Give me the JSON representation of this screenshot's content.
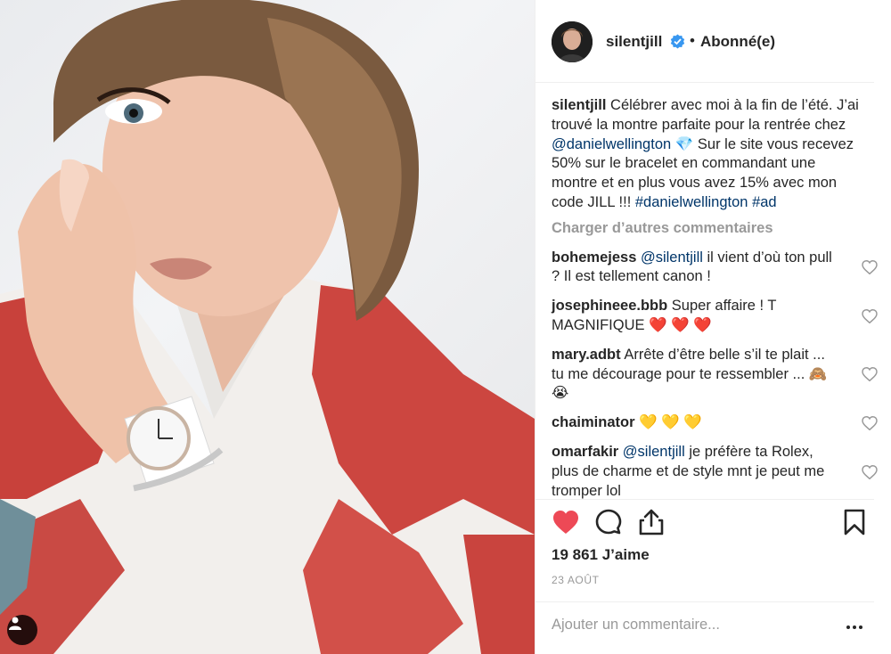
{
  "header": {
    "username": "silentjill",
    "separator": "•",
    "follow_status": "Abonné(e)"
  },
  "caption": {
    "username": "silentjill",
    "text_1": "Célébrer avec moi à la fin de l’été. J’ai trouvé la montre parfaite pour la rentrée chez ",
    "mention": "@danielwellington",
    "emoji": "💎",
    "text_2": "  Sur le site vous recevez 50% sur le bracelet en commandant une montre et en plus vous avez 15% avec mon code JILL !!! ",
    "hashtag_1": "#danielwellington",
    "hashtag_2": "#ad"
  },
  "load_more": "Charger d’autres commentaires",
  "comments": [
    {
      "username": "bohemejess",
      "mention": "@silentjill",
      "text": " il vient d’où ton pull ? Il est tellement canon !"
    },
    {
      "username": "josephineee.bbb",
      "mention": "",
      "text": "Super affaire ! T MAGNIFIQUE ❤️ ❤️ ❤️"
    },
    {
      "username": "mary.adbt",
      "mention": "",
      "text": "Arrête d’être belle s’il te plait ... tu me décourage pour te ressembler ... 🙈 😭"
    },
    {
      "username": "chaiminator",
      "mention": "",
      "text": "💛 💛 💛"
    },
    {
      "username": "omarfakir",
      "mention": "@silentjill",
      "text": " je préfère ta Rolex, plus de charme et de style mnt je peut me tromper lol"
    }
  ],
  "likes": "19 861 J’aime",
  "date": "23 AOÛT",
  "add_comment": {
    "placeholder": "Ajouter un commentaire..."
  },
  "icons": {
    "like": "heart-filled-icon",
    "comment": "comment-bubble-icon",
    "share": "share-icon",
    "save": "bookmark-icon",
    "more": "more-options-icon",
    "tagged": "person-tag-icon",
    "verified": "verified-badge-icon"
  },
  "colors": {
    "like_red": "#ed4956",
    "link_blue": "#003569",
    "verified_blue": "#3897f0",
    "muted": "#999999",
    "text": "#262626"
  }
}
